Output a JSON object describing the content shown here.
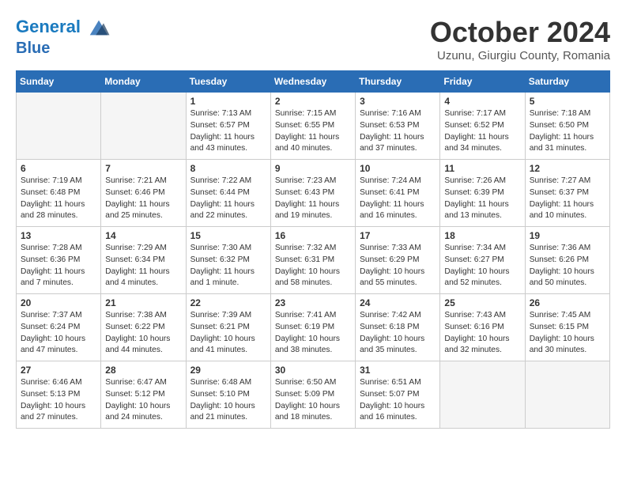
{
  "header": {
    "logo_line1": "General",
    "logo_line2": "Blue",
    "month_title": "October 2024",
    "location": "Uzunu, Giurgiu County, Romania"
  },
  "weekdays": [
    "Sunday",
    "Monday",
    "Tuesday",
    "Wednesday",
    "Thursday",
    "Friday",
    "Saturday"
  ],
  "weeks": [
    [
      {
        "day": "",
        "info": "",
        "empty": true
      },
      {
        "day": "",
        "info": "",
        "empty": true
      },
      {
        "day": "1",
        "info": "Sunrise: 7:13 AM\nSunset: 6:57 PM\nDaylight: 11 hours\nand 43 minutes."
      },
      {
        "day": "2",
        "info": "Sunrise: 7:15 AM\nSunset: 6:55 PM\nDaylight: 11 hours\nand 40 minutes."
      },
      {
        "day": "3",
        "info": "Sunrise: 7:16 AM\nSunset: 6:53 PM\nDaylight: 11 hours\nand 37 minutes."
      },
      {
        "day": "4",
        "info": "Sunrise: 7:17 AM\nSunset: 6:52 PM\nDaylight: 11 hours\nand 34 minutes."
      },
      {
        "day": "5",
        "info": "Sunrise: 7:18 AM\nSunset: 6:50 PM\nDaylight: 11 hours\nand 31 minutes."
      }
    ],
    [
      {
        "day": "6",
        "info": "Sunrise: 7:19 AM\nSunset: 6:48 PM\nDaylight: 11 hours\nand 28 minutes."
      },
      {
        "day": "7",
        "info": "Sunrise: 7:21 AM\nSunset: 6:46 PM\nDaylight: 11 hours\nand 25 minutes."
      },
      {
        "day": "8",
        "info": "Sunrise: 7:22 AM\nSunset: 6:44 PM\nDaylight: 11 hours\nand 22 minutes."
      },
      {
        "day": "9",
        "info": "Sunrise: 7:23 AM\nSunset: 6:43 PM\nDaylight: 11 hours\nand 19 minutes."
      },
      {
        "day": "10",
        "info": "Sunrise: 7:24 AM\nSunset: 6:41 PM\nDaylight: 11 hours\nand 16 minutes."
      },
      {
        "day": "11",
        "info": "Sunrise: 7:26 AM\nSunset: 6:39 PM\nDaylight: 11 hours\nand 13 minutes."
      },
      {
        "day": "12",
        "info": "Sunrise: 7:27 AM\nSunset: 6:37 PM\nDaylight: 11 hours\nand 10 minutes."
      }
    ],
    [
      {
        "day": "13",
        "info": "Sunrise: 7:28 AM\nSunset: 6:36 PM\nDaylight: 11 hours\nand 7 minutes."
      },
      {
        "day": "14",
        "info": "Sunrise: 7:29 AM\nSunset: 6:34 PM\nDaylight: 11 hours\nand 4 minutes."
      },
      {
        "day": "15",
        "info": "Sunrise: 7:30 AM\nSunset: 6:32 PM\nDaylight: 11 hours\nand 1 minute."
      },
      {
        "day": "16",
        "info": "Sunrise: 7:32 AM\nSunset: 6:31 PM\nDaylight: 10 hours\nand 58 minutes."
      },
      {
        "day": "17",
        "info": "Sunrise: 7:33 AM\nSunset: 6:29 PM\nDaylight: 10 hours\nand 55 minutes."
      },
      {
        "day": "18",
        "info": "Sunrise: 7:34 AM\nSunset: 6:27 PM\nDaylight: 10 hours\nand 52 minutes."
      },
      {
        "day": "19",
        "info": "Sunrise: 7:36 AM\nSunset: 6:26 PM\nDaylight: 10 hours\nand 50 minutes."
      }
    ],
    [
      {
        "day": "20",
        "info": "Sunrise: 7:37 AM\nSunset: 6:24 PM\nDaylight: 10 hours\nand 47 minutes."
      },
      {
        "day": "21",
        "info": "Sunrise: 7:38 AM\nSunset: 6:22 PM\nDaylight: 10 hours\nand 44 minutes."
      },
      {
        "day": "22",
        "info": "Sunrise: 7:39 AM\nSunset: 6:21 PM\nDaylight: 10 hours\nand 41 minutes."
      },
      {
        "day": "23",
        "info": "Sunrise: 7:41 AM\nSunset: 6:19 PM\nDaylight: 10 hours\nand 38 minutes."
      },
      {
        "day": "24",
        "info": "Sunrise: 7:42 AM\nSunset: 6:18 PM\nDaylight: 10 hours\nand 35 minutes."
      },
      {
        "day": "25",
        "info": "Sunrise: 7:43 AM\nSunset: 6:16 PM\nDaylight: 10 hours\nand 32 minutes."
      },
      {
        "day": "26",
        "info": "Sunrise: 7:45 AM\nSunset: 6:15 PM\nDaylight: 10 hours\nand 30 minutes."
      }
    ],
    [
      {
        "day": "27",
        "info": "Sunrise: 6:46 AM\nSunset: 5:13 PM\nDaylight: 10 hours\nand 27 minutes."
      },
      {
        "day": "28",
        "info": "Sunrise: 6:47 AM\nSunset: 5:12 PM\nDaylight: 10 hours\nand 24 minutes."
      },
      {
        "day": "29",
        "info": "Sunrise: 6:48 AM\nSunset: 5:10 PM\nDaylight: 10 hours\nand 21 minutes."
      },
      {
        "day": "30",
        "info": "Sunrise: 6:50 AM\nSunset: 5:09 PM\nDaylight: 10 hours\nand 18 minutes."
      },
      {
        "day": "31",
        "info": "Sunrise: 6:51 AM\nSunset: 5:07 PM\nDaylight: 10 hours\nand 16 minutes."
      },
      {
        "day": "",
        "info": "",
        "empty": true
      },
      {
        "day": "",
        "info": "",
        "empty": true
      }
    ]
  ]
}
